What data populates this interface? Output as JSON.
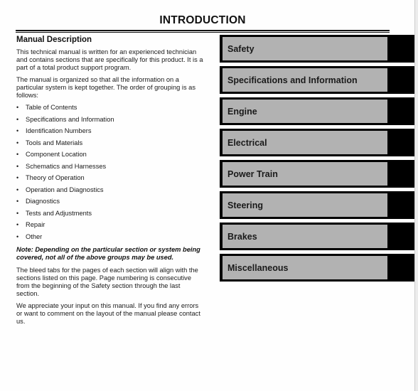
{
  "page": {
    "title": "INTRODUCTION"
  },
  "manual_description": {
    "heading": "Manual Description",
    "paragraph_1": "This technical manual is written for an experienced technician and contains sections that are specifically for this product. It is a part of a total product support program.",
    "paragraph_2": "The manual is organized so that all the information on a particular system is kept together. The order of grouping is as follows:",
    "groups": [
      "Table of Contents",
      "Specifications and Information",
      "Identification Numbers",
      "Tools and Materials",
      "Component Location",
      "Schematics and Harnesses",
      "Theory of Operation",
      "Operation and Diagnostics",
      "Diagnostics",
      "Tests and Adjustments",
      "Repair",
      "Other"
    ],
    "bullet": "•",
    "note": "Note: Depending on the particular section or system being covered, not all of the above groups may be used.",
    "paragraph_3": "The bleed tabs for the pages of each section will align with the sections listed on this page. Page numbering is consecutive from the beginning of the Safety section through the last section.",
    "paragraph_4": "We appreciate your input on this manual. If you find any errors or want to comment on the layout of the manual please contact us."
  },
  "section_tabs": [
    {
      "label": "Safety"
    },
    {
      "label": "Specifications and Information"
    },
    {
      "label": "Engine"
    },
    {
      "label": "Electrical"
    },
    {
      "label": "Power Train"
    },
    {
      "label": "Steering"
    },
    {
      "label": "Brakes"
    },
    {
      "label": "Miscellaneous"
    }
  ],
  "colors": {
    "tab_outer": "#000000",
    "tab_inner": "#b2b2b2"
  }
}
